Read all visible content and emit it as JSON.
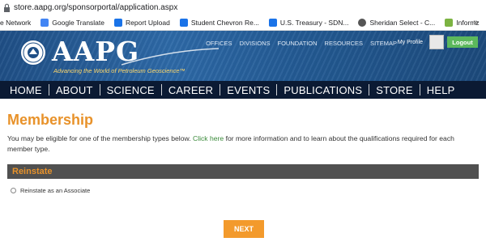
{
  "browser": {
    "url": "store.aapg.org/sponsorportal/application.aspx",
    "bookmarks": [
      {
        "label": "e Network",
        "icon": "none",
        "color": ""
      },
      {
        "label": "Google Translate",
        "icon": "translate-icon",
        "color": "#4285f4"
      },
      {
        "label": "Report Upload",
        "icon": "page-icon",
        "color": "#1a73e8"
      },
      {
        "label": "Student Chevron Re...",
        "icon": "page-icon",
        "color": "#1a73e8"
      },
      {
        "label": "U.S. Treasury - SDN...",
        "icon": "page-icon",
        "color": "#1a73e8"
      },
      {
        "label": "Sheridan Select - C...",
        "icon": "globe-icon",
        "color": "#555555"
      },
      {
        "label": "Informz",
        "icon": "informz-icon",
        "color": "#7cb342"
      }
    ],
    "more": "»"
  },
  "header": {
    "logo": "AAPG",
    "tagline": "Advancing the World of Petroleum Geoscience™",
    "top_links": [
      "OFFICES",
      "DIVISIONS",
      "FOUNDATION",
      "RESOURCES",
      "SITEMAP"
    ],
    "my_profile": "My Profile",
    "logout": "Logout"
  },
  "nav": [
    "HOME",
    "ABOUT",
    "SCIENCE",
    "CAREER",
    "EVENTS",
    "PUBLICATIONS",
    "STORE",
    "HELP"
  ],
  "page": {
    "title": "Membership",
    "intro_before": "You may be eligible for one of the membership types below. ",
    "intro_link": "Click here",
    "intro_after": " for more information and to learn about the qualifications required for each member type.",
    "section": "Reinstate",
    "option": "Reinstate as an Associate",
    "next": "NEXT"
  },
  "colors": {
    "accent": "#e8922a",
    "nav_bg": "#0b1a33",
    "logout": "#5cb85c",
    "next": "#f39a2c"
  }
}
